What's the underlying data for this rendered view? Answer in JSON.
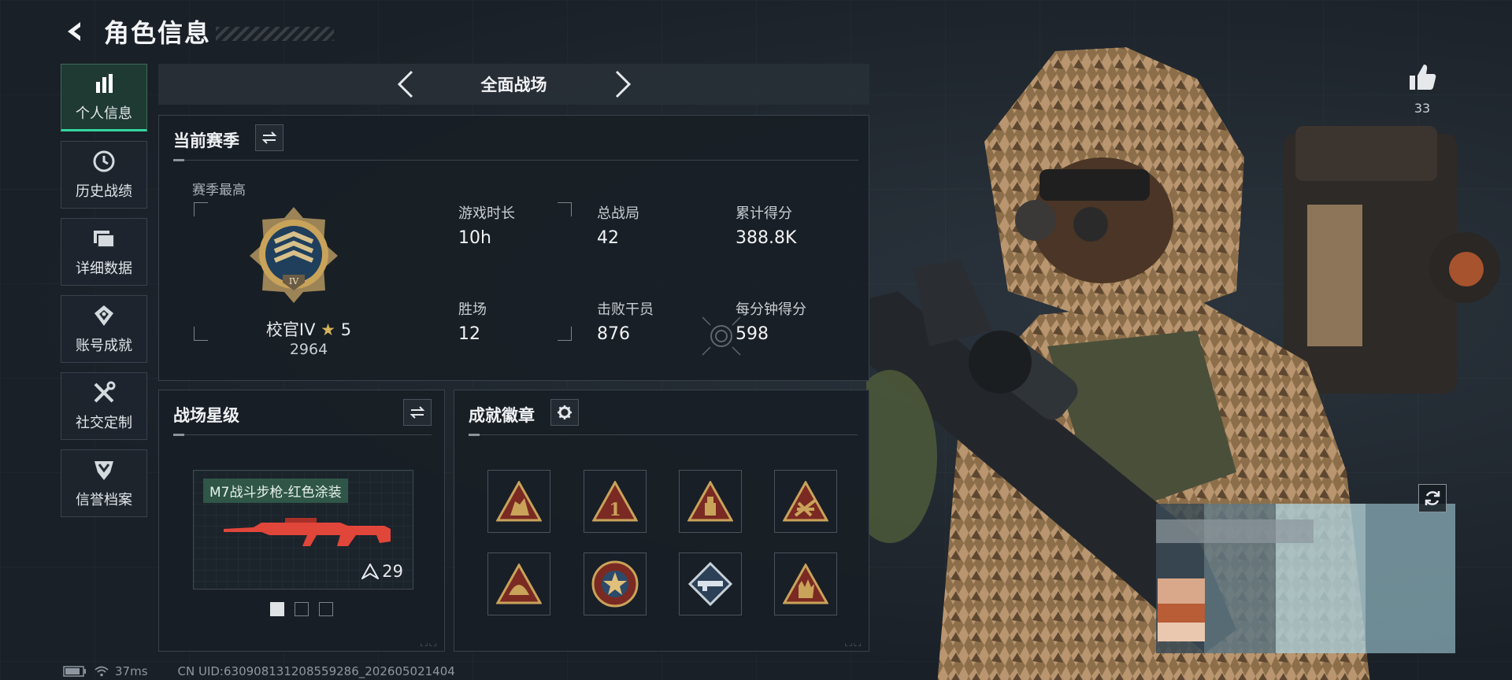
{
  "header": {
    "title": "角色信息"
  },
  "sidebar": {
    "items": [
      {
        "label": "个人信息",
        "icon": "bar-chart-icon",
        "active": true
      },
      {
        "label": "历史战绩",
        "icon": "clock-icon",
        "active": false
      },
      {
        "label": "详细数据",
        "icon": "folder-icon",
        "active": false
      },
      {
        "label": "账号成就",
        "icon": "achievement-icon",
        "active": false
      },
      {
        "label": "社交定制",
        "icon": "tools-icon",
        "active": false
      },
      {
        "label": "信誉档案",
        "icon": "shield-icon",
        "active": false
      }
    ]
  },
  "mode": {
    "title": "全面战场"
  },
  "season": {
    "title": "当前赛季",
    "best_label": "赛季最高",
    "rank_name": "校官IV",
    "rank_stars": "5",
    "rank_points": "2964",
    "stats": [
      {
        "label": "游戏时长",
        "value": "10h"
      },
      {
        "label": "总战局",
        "value": "42"
      },
      {
        "label": "累计得分",
        "value": "388.8K"
      },
      {
        "label": "胜场",
        "value": "12"
      },
      {
        "label": "击败干员",
        "value": "876"
      },
      {
        "label": "每分钟得分",
        "value": "598"
      }
    ]
  },
  "battlefield_stars": {
    "title": "战场星级",
    "weapon_name": "M7战斗步枪-红色涂装",
    "weapon_stars": "29",
    "pages": 3,
    "active_page": 0
  },
  "badges": {
    "title": "成就徽章",
    "items": [
      {
        "icon": "soldiers-badge-icon"
      },
      {
        "icon": "number-one-badge-icon"
      },
      {
        "icon": "ammo-badge-icon"
      },
      {
        "icon": "barricade-badge-icon"
      },
      {
        "icon": "helmet-badge-icon"
      },
      {
        "icon": "star-emblem-badge-icon"
      },
      {
        "icon": "diamond-rifle-badge-icon"
      },
      {
        "icon": "hand-sign-badge-icon"
      }
    ]
  },
  "likes": {
    "count": "33"
  },
  "footer": {
    "ping": "37ms",
    "uid": "CN UID:630908131208559286_202605021404"
  },
  "colors": {
    "accent": "#33d69f",
    "badge_gold": "#c9a35a",
    "badge_red": "#7a2a22",
    "weapon_red": "#e0463a"
  }
}
